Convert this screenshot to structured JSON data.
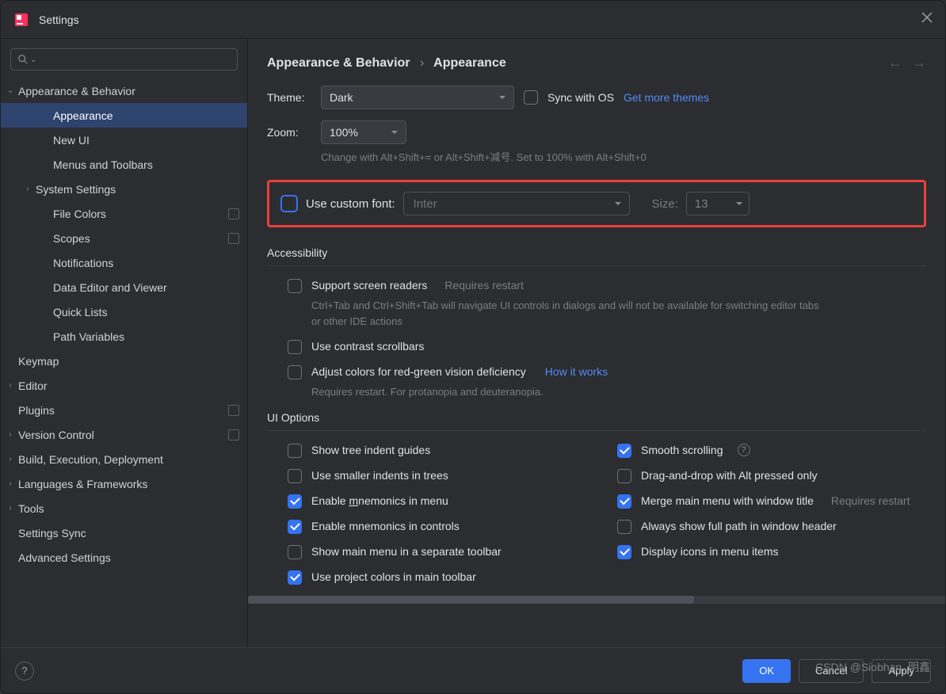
{
  "window_title": "Settings",
  "breadcrumb": {
    "parent": "Appearance & Behavior",
    "current": "Appearance"
  },
  "sidebar": {
    "items": [
      {
        "label": "Appearance & Behavior",
        "lv": 0,
        "arrow": "down"
      },
      {
        "label": "Appearance",
        "lv": 2,
        "sel": true
      },
      {
        "label": "New UI",
        "lv": 2
      },
      {
        "label": "Menus and Toolbars",
        "lv": 2
      },
      {
        "label": "System Settings",
        "lv": 1,
        "arrow": "right"
      },
      {
        "label": "File Colors",
        "lv": 2,
        "badge": true
      },
      {
        "label": "Scopes",
        "lv": 2,
        "badge": true
      },
      {
        "label": "Notifications",
        "lv": 2
      },
      {
        "label": "Data Editor and Viewer",
        "lv": 2
      },
      {
        "label": "Quick Lists",
        "lv": 2
      },
      {
        "label": "Path Variables",
        "lv": 2
      },
      {
        "label": "Keymap",
        "lv": 0,
        "plain": true
      },
      {
        "label": "Editor",
        "lv": 0,
        "arrow": "right"
      },
      {
        "label": "Plugins",
        "lv": 0,
        "plain": true,
        "badge": true
      },
      {
        "label": "Version Control",
        "lv": 0,
        "arrow": "right",
        "badge": true
      },
      {
        "label": "Build, Execution, Deployment",
        "lv": 0,
        "arrow": "right"
      },
      {
        "label": "Languages & Frameworks",
        "lv": 0,
        "arrow": "right"
      },
      {
        "label": "Tools",
        "lv": 0,
        "arrow": "right"
      },
      {
        "label": "Settings Sync",
        "lv": 0,
        "plain": true
      },
      {
        "label": "Advanced Settings",
        "lv": 0,
        "plain": true
      }
    ]
  },
  "theme": {
    "label": "Theme:",
    "value": "Dark",
    "sync": "Sync with OS",
    "more": "Get more themes"
  },
  "zoom": {
    "label": "Zoom:",
    "value": "100%",
    "hint": "Change with Alt+Shift+= or Alt+Shift+减号. Set to 100% with Alt+Shift+0"
  },
  "custom_font": {
    "label": "Use custom font:",
    "placeholder": "Inter",
    "size_label": "Size:",
    "size_value": "13"
  },
  "accessibility": {
    "title": "Accessibility",
    "screen_readers": {
      "label": "Support screen readers",
      "suffix": "Requires restart",
      "hint": "Ctrl+Tab and Ctrl+Shift+Tab will navigate UI controls in dialogs and will not be available for switching editor tabs or other IDE actions"
    },
    "contrast": "Use contrast scrollbars",
    "color_def": {
      "label": "Adjust colors for red-green vision deficiency",
      "link": "How it works",
      "hint": "Requires restart. For protanopia and deuteranopia."
    }
  },
  "ui_options": {
    "title": "UI Options",
    "left": [
      {
        "label": "Show tree indent guides",
        "checked": false
      },
      {
        "label": "Use smaller indents in trees",
        "checked": false
      },
      {
        "label": "Enable mnemonics in menu",
        "checked": true,
        "u": "m"
      },
      {
        "label": "Enable mnemonics in controls",
        "checked": true
      },
      {
        "label": "Show main menu in a separate toolbar",
        "checked": false
      },
      {
        "label": "Use project colors in main toolbar",
        "checked": true
      }
    ],
    "right": [
      {
        "label": "Smooth scrolling",
        "checked": true,
        "help": true
      },
      {
        "label": "Drag-and-drop with Alt pressed only",
        "checked": false
      },
      {
        "label": "Merge main menu with window title",
        "checked": true,
        "suffix": "Requires restart"
      },
      {
        "label": "Always show full path in window header",
        "checked": false
      },
      {
        "label": "Display icons in menu items",
        "checked": true
      }
    ]
  },
  "footer": {
    "ok": "OK",
    "cancel": "Cancel",
    "apply": "Apply"
  },
  "watermark": "CSDN @Siobhan. 明鑫"
}
